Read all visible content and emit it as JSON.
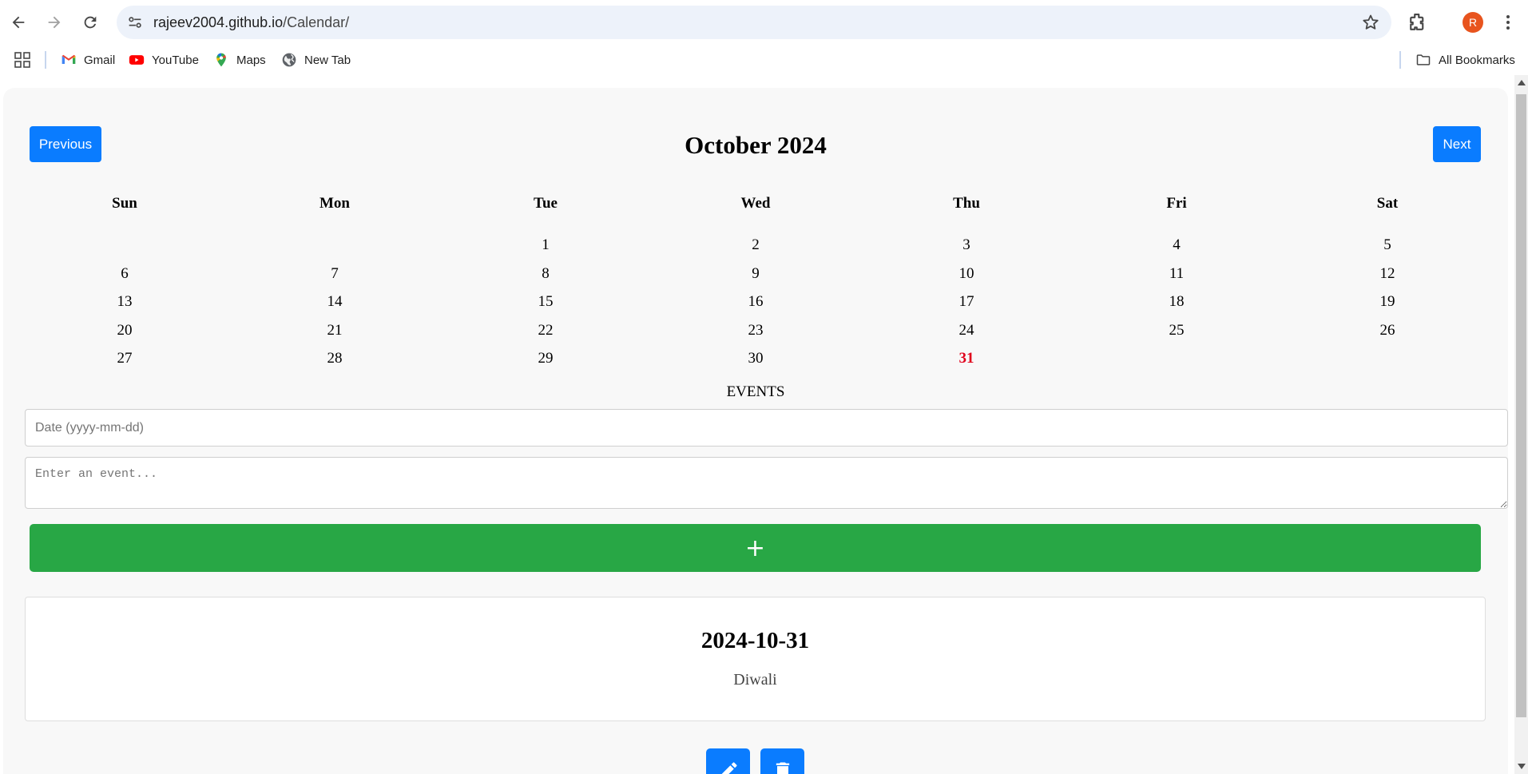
{
  "browser": {
    "url_host": "rajeev2004.github.io",
    "url_path": "/Calendar/",
    "profile_initial": "R",
    "bookmarks": [
      {
        "label": "Gmail",
        "icon": "gmail-icon"
      },
      {
        "label": "YouTube",
        "icon": "youtube-icon"
      },
      {
        "label": "Maps",
        "icon": "maps-icon"
      },
      {
        "label": "New Tab",
        "icon": "globe-icon"
      }
    ],
    "all_bookmarks_label": "All Bookmarks"
  },
  "calendar": {
    "month_title": "October 2024",
    "previous_label": "Previous",
    "next_label": "Next",
    "weekdays": [
      "Sun",
      "Mon",
      "Tue",
      "Wed",
      "Thu",
      "Fri",
      "Sat"
    ],
    "weeks": [
      [
        "",
        "",
        "1",
        "2",
        "3",
        "4",
        "5"
      ],
      [
        "6",
        "7",
        "8",
        "9",
        "10",
        "11",
        "12"
      ],
      [
        "13",
        "14",
        "15",
        "16",
        "17",
        "18",
        "19"
      ],
      [
        "20",
        "21",
        "22",
        "23",
        "24",
        "25",
        "26"
      ],
      [
        "27",
        "28",
        "29",
        "30",
        "31",
        "",
        ""
      ]
    ],
    "highlighted_day": "31",
    "highlight_color": "#e0001b"
  },
  "events": {
    "heading": "EVENTS",
    "date_placeholder": "Date (yyyy-mm-dd)",
    "event_placeholder": "Enter an event...",
    "add_label": "+",
    "list": [
      {
        "date": "2024-10-31",
        "text": "Diwali"
      }
    ]
  },
  "colors": {
    "primary": "#0a7cff",
    "add": "#28a745"
  }
}
